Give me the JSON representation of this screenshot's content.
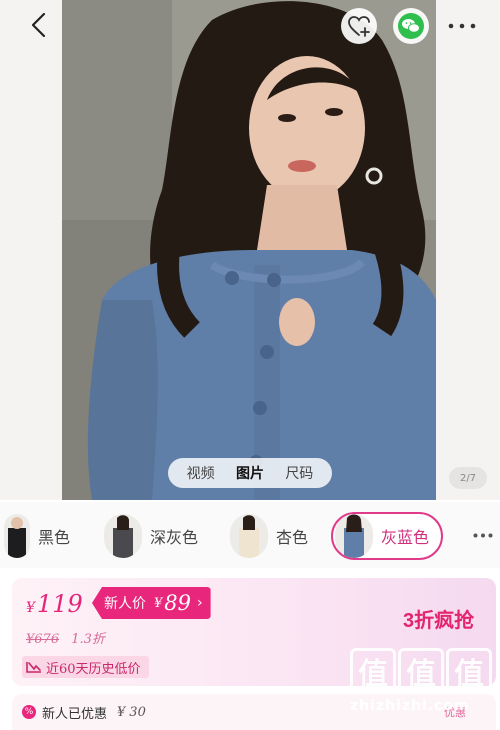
{
  "header": {
    "back_icon": "chevron-left-icon",
    "favorite_icon": "heart-plus-icon",
    "share_icon": "wechat-icon",
    "more_icon": "ellipsis-icon"
  },
  "gallery": {
    "tabs": [
      {
        "label": "视频",
        "active": false
      },
      {
        "label": "图片",
        "active": true
      },
      {
        "label": "尺码",
        "active": false
      }
    ],
    "page_indicator": "2/7"
  },
  "colors": {
    "options": [
      {
        "label": "黑色",
        "selected": false
      },
      {
        "label": "深灰色",
        "selected": false
      },
      {
        "label": "杏色",
        "selected": false
      },
      {
        "label": "灰蓝色",
        "selected": true
      }
    ],
    "more_icon": "ellipsis-icon"
  },
  "price": {
    "currency": "¥",
    "current": "119",
    "newcomer_label": "新人价",
    "newcomer_currency": "¥",
    "newcomer_price": "89",
    "original": "¥676",
    "discount": "1.3折",
    "history_badge": "近60天历史低价",
    "promo": "3折疯抢",
    "accent_color": "#e8267b"
  },
  "coupon": {
    "label": "新人已优惠",
    "currency": "¥",
    "amount": "30",
    "tail": "优惠"
  },
  "watermark": {
    "logo_char": "值",
    "site": "zhizhizhi.com"
  }
}
